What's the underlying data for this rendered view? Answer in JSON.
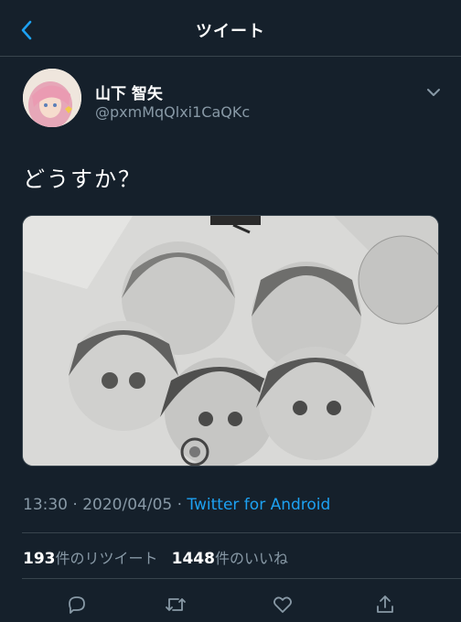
{
  "header": {
    "title": "ツイート",
    "back_icon": "chevron-left-icon"
  },
  "author": {
    "display_name": "山下 智矢",
    "handle": "@pxmMqQlxi1CaQKc"
  },
  "tweet": {
    "text": "どうすか？"
  },
  "meta": {
    "time": "13:30",
    "date": "2020/04/05",
    "separator": "·",
    "source": "Twitter for Android"
  },
  "stats": {
    "retweets_count": "193",
    "retweets_label": "件のリツイート",
    "likes_count": "1448",
    "likes_label": "件のいいね"
  },
  "actions": [
    "reply-icon",
    "retweet-icon",
    "like-icon",
    "share-icon"
  ],
  "colors": {
    "background": "#15202b",
    "accent": "#1da1f2",
    "muted": "#8899a6",
    "divider": "#38444d"
  }
}
